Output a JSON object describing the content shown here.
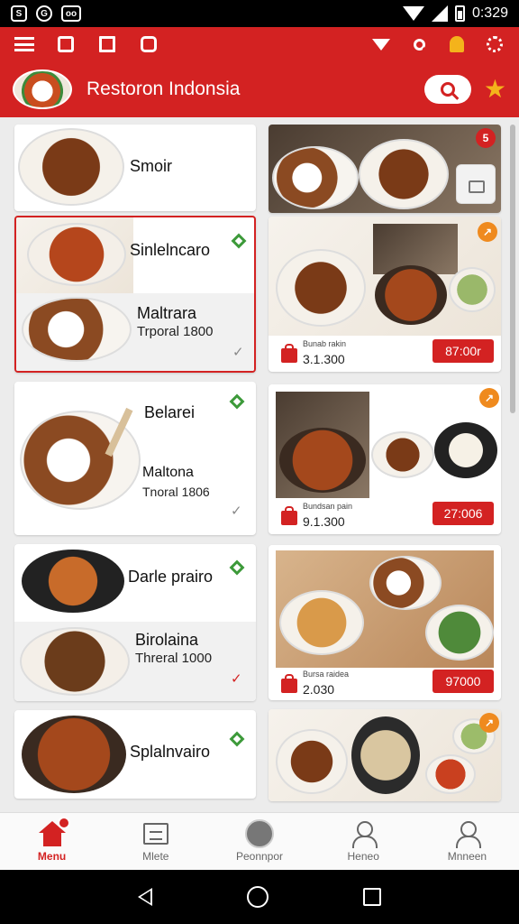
{
  "status_bar": {
    "time": "0:329",
    "left_icons": [
      "app-notification-icon",
      "sync-icon",
      "message-icon"
    ],
    "left_glyphs": [
      "S",
      "G",
      "oo"
    ]
  },
  "header": {
    "title": "Restoron Indonsia",
    "tool_icons_left": [
      "menu-icon",
      "cart-icon",
      "calendar-icon",
      "gift-icon"
    ],
    "tool_icons_right": [
      "wifi-icon",
      "search-small-icon",
      "user-icon",
      "settings-icon"
    ]
  },
  "colors": {
    "accent": "#d32222",
    "badge": "#ef8a1e",
    "green": "#3d9a3a"
  },
  "left_cards": [
    {
      "name": "Smoir"
    },
    {
      "name": "Sinlelncaro",
      "sub_name": "Maltrara",
      "sub_price": "Trporal 1800"
    },
    {
      "name": "Belarei",
      "sub_name": "Maltona",
      "sub_price": "Tnoral 1806"
    },
    {
      "name": "Darle prairo",
      "sub_name": "Birolaina",
      "sub_price": "Threral 1000"
    },
    {
      "name": "Splalnvairo"
    }
  ],
  "right_cards": [
    {
      "badge": "5"
    },
    {
      "badge": "↗",
      "small_label": "Bunab rakin",
      "price_left": "3.1.300",
      "price_button": "87:00r"
    },
    {
      "badge": "↗",
      "small_label": "Bundsan pain",
      "price_left": "9.1.300",
      "price_button": "27:006"
    },
    {
      "small_label": "Bursa raidea",
      "price_left": "2.030",
      "price_button": "97000"
    },
    {
      "badge": "↗"
    }
  ],
  "bottom_nav": [
    {
      "label": "Menu",
      "icon": "home-icon",
      "active": true
    },
    {
      "label": "Mlete",
      "icon": "menu-list-icon",
      "active": false
    },
    {
      "label": "Peonnpor",
      "icon": "profile-circle-icon",
      "active": false
    },
    {
      "label": "Heneo",
      "icon": "person-icon",
      "active": false
    },
    {
      "label": "Mnneen",
      "icon": "account-icon",
      "active": false
    }
  ]
}
